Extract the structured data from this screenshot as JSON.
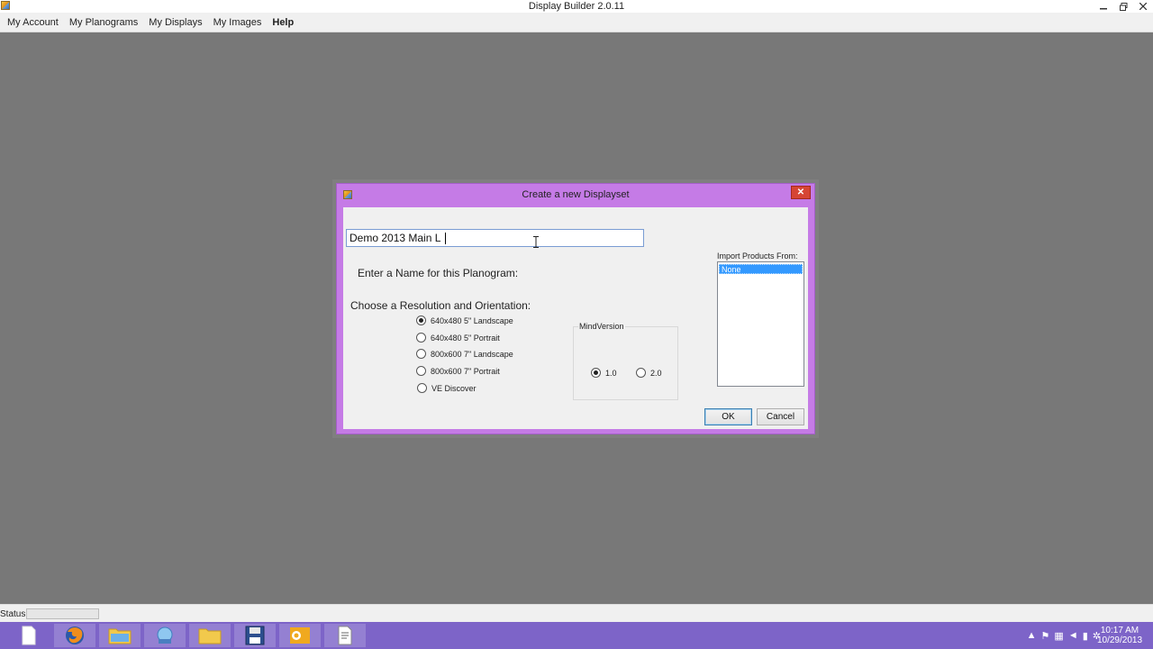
{
  "app": {
    "title": "Display Builder 2.0.11"
  },
  "menu": {
    "items": [
      {
        "label": "My Account"
      },
      {
        "label": "My Planograms"
      },
      {
        "label": "My Displays"
      },
      {
        "label": "My Images"
      },
      {
        "label": "Help"
      }
    ]
  },
  "dialog": {
    "title": "Create a new Displayset",
    "name_input": {
      "value": "Demo 2013 Main L"
    },
    "name_label": "Enter a Name for this Planogram:",
    "resolution_label": "Choose a Resolution and Orientation:",
    "resolutions": [
      {
        "label": "640x480 5\" Landscape",
        "checked": true
      },
      {
        "label": "640x480 5\" Portrait",
        "checked": false
      },
      {
        "label": "800x600 7\" Landscape",
        "checked": false
      },
      {
        "label": "800x600 7\" Portrait",
        "checked": false
      },
      {
        "label": "VE Discover",
        "checked": false
      }
    ],
    "mind_version": {
      "legend": "MindVersion",
      "options": [
        {
          "label": "1.0",
          "checked": true
        },
        {
          "label": "2.0",
          "checked": false
        }
      ]
    },
    "import": {
      "label": "Import Products From:",
      "options": [
        {
          "label": "None",
          "selected": true
        }
      ]
    },
    "ok_label": "OK",
    "cancel_label": "Cancel"
  },
  "status": {
    "label": "Status"
  },
  "clock": {
    "time": "10:17 AM",
    "date": "10/29/2013"
  },
  "colors": {
    "dialog_frame": "#c57be6",
    "taskbar": "#7d64c8",
    "desktop": "#787878",
    "selection": "#3399ff"
  },
  "taskbar": {
    "icons": [
      "file-icon",
      "firefox-icon",
      "folder-icon",
      "network-icon",
      "explorer-icon",
      "save-icon",
      "outlook-icon",
      "document-icon"
    ]
  }
}
